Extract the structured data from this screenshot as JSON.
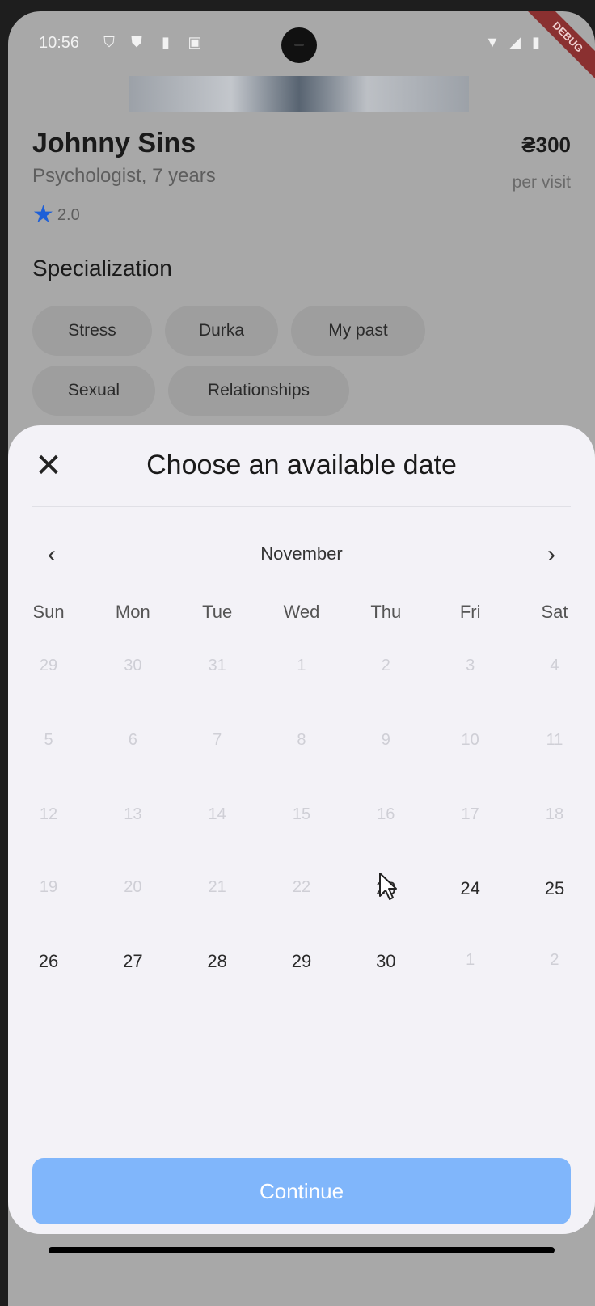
{
  "status_bar": {
    "time": "10:56"
  },
  "debug_banner": "DEBUG",
  "doctor": {
    "name": "Johnny Sins",
    "subtitle": "Psychologist, 7 years",
    "rating": "2.0",
    "price": "₴300",
    "price_unit": "per visit"
  },
  "specialization": {
    "title": "Specialization",
    "chips": [
      "Stress",
      "Durka",
      "My past",
      "Sexual",
      "Relationships"
    ]
  },
  "date_sheet": {
    "title": "Choose an available date",
    "month": "November",
    "weekdays": [
      "Sun",
      "Mon",
      "Tue",
      "Wed",
      "Thu",
      "Fri",
      "Sat"
    ],
    "weeks": [
      [
        {
          "d": "29",
          "on": false
        },
        {
          "d": "30",
          "on": false
        },
        {
          "d": "31",
          "on": false
        },
        {
          "d": "1",
          "on": false
        },
        {
          "d": "2",
          "on": false
        },
        {
          "d": "3",
          "on": false
        },
        {
          "d": "4",
          "on": false
        }
      ],
      [
        {
          "d": "5",
          "on": false
        },
        {
          "d": "6",
          "on": false
        },
        {
          "d": "7",
          "on": false
        },
        {
          "d": "8",
          "on": false
        },
        {
          "d": "9",
          "on": false
        },
        {
          "d": "10",
          "on": false
        },
        {
          "d": "11",
          "on": false
        }
      ],
      [
        {
          "d": "12",
          "on": false
        },
        {
          "d": "13",
          "on": false
        },
        {
          "d": "14",
          "on": false
        },
        {
          "d": "15",
          "on": false
        },
        {
          "d": "16",
          "on": false
        },
        {
          "d": "17",
          "on": false
        },
        {
          "d": "18",
          "on": false
        }
      ],
      [
        {
          "d": "19",
          "on": false
        },
        {
          "d": "20",
          "on": false
        },
        {
          "d": "21",
          "on": false
        },
        {
          "d": "22",
          "on": false
        },
        {
          "d": "23",
          "on": true
        },
        {
          "d": "24",
          "on": true
        },
        {
          "d": "25",
          "on": true
        }
      ],
      [
        {
          "d": "26",
          "on": true
        },
        {
          "d": "27",
          "on": true
        },
        {
          "d": "28",
          "on": true
        },
        {
          "d": "29",
          "on": true
        },
        {
          "d": "30",
          "on": true
        },
        {
          "d": "1",
          "on": false
        },
        {
          "d": "2",
          "on": false
        }
      ]
    ],
    "continue_label": "Continue"
  },
  "icons": {
    "close": "close-icon",
    "prev": "chevron-left-icon",
    "next": "chevron-right-icon",
    "star": "star-icon"
  },
  "colors": {
    "accent": "#1d5fd8",
    "button_disabled": "#80b6fb"
  }
}
